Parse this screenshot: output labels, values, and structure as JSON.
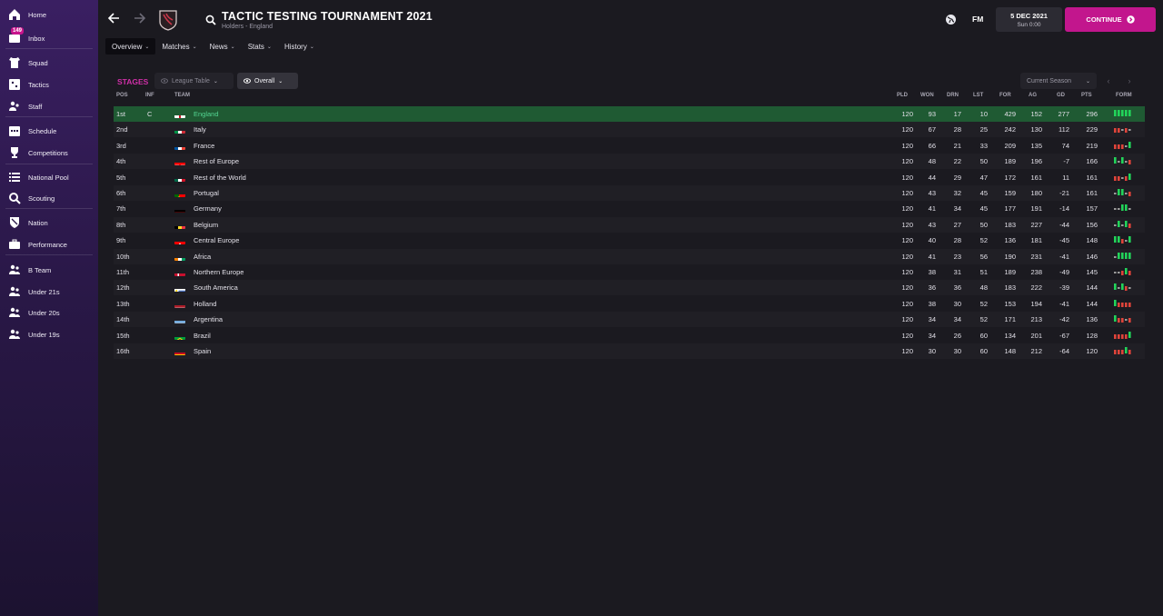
{
  "colors": {
    "accent": "#c2168d",
    "stages": "#d02fa8",
    "leader_row": "#1f5a33",
    "leader_text": "#53d692",
    "win": "#22d45a",
    "draw": "#9a9a9a",
    "loss": "#e0443a"
  },
  "sidebar": {
    "inbox_badge": "149",
    "items": [
      {
        "label": "Home",
        "icon": "home-icon"
      },
      {
        "label": "Inbox",
        "icon": "inbox-icon"
      },
      {
        "label": "Squad",
        "icon": "shirt-icon"
      },
      {
        "label": "Tactics",
        "icon": "tactics-board-icon"
      },
      {
        "label": "Staff",
        "icon": "staff-icon"
      },
      {
        "label": "Schedule",
        "icon": "calendar-icon"
      },
      {
        "label": "Competitions",
        "icon": "trophy-icon"
      },
      {
        "label": "National Pool",
        "icon": "list-icon"
      },
      {
        "label": "Scouting",
        "icon": "magnifier-icon"
      },
      {
        "label": "Nation",
        "icon": "shield-icon"
      },
      {
        "label": "Performance",
        "icon": "briefcase-icon"
      },
      {
        "label": "B Team",
        "icon": "b-team-icon"
      },
      {
        "label": "Under 21s",
        "icon": "under-21-icon"
      },
      {
        "label": "Under 20s",
        "icon": "under-20-icon"
      },
      {
        "label": "Under 19s",
        "icon": "under-19-icon"
      }
    ]
  },
  "header": {
    "title": "TACTIC TESTING TOURNAMENT 2021",
    "subtitle": "Holders - England",
    "fm_label": "FM",
    "date": "5 DEC 2021",
    "time": "Sun 0:00",
    "continue_label": "CONTINUE"
  },
  "tabs": [
    {
      "label": "Overview",
      "active": true
    },
    {
      "label": "Matches",
      "active": false
    },
    {
      "label": "News",
      "active": false
    },
    {
      "label": "Stats",
      "active": false
    },
    {
      "label": "History",
      "active": false
    }
  ],
  "stages": {
    "label": "STAGES",
    "league_table": "League Table",
    "overall": "Overall",
    "season": "Current Season"
  },
  "table": {
    "headers": {
      "pos": "POS",
      "inf": "INF",
      "team": "TEAM",
      "pld": "PLD",
      "won": "WON",
      "drn": "DRN",
      "lst": "LST",
      "for": "FOR",
      "ag": "AG",
      "gd": "GD",
      "pts": "PTS",
      "form": "FORM"
    },
    "rows": [
      {
        "pos": "1st",
        "inf": "C",
        "team": "England",
        "flag": "england",
        "pld": "120",
        "won": "93",
        "drn": "17",
        "lst": "10",
        "for": "429",
        "ag": "152",
        "gd": "277",
        "pts": "296",
        "form": [
          "W",
          "W",
          "W",
          "W",
          "W"
        ]
      },
      {
        "pos": "2nd",
        "inf": "",
        "team": "Italy",
        "flag": "italy",
        "pld": "120",
        "won": "67",
        "drn": "28",
        "lst": "25",
        "for": "242",
        "ag": "130",
        "gd": "112",
        "pts": "229",
        "form": [
          "L",
          "L",
          "D",
          "L",
          "D"
        ]
      },
      {
        "pos": "3rd",
        "inf": "",
        "team": "France",
        "flag": "france",
        "pld": "120",
        "won": "66",
        "drn": "21",
        "lst": "33",
        "for": "209",
        "ag": "135",
        "gd": "74",
        "pts": "219",
        "form": [
          "L",
          "L",
          "L",
          "D",
          "W"
        ]
      },
      {
        "pos": "4th",
        "inf": "",
        "team": "Rest of Europe",
        "flag": "croatia",
        "pld": "120",
        "won": "48",
        "drn": "22",
        "lst": "50",
        "for": "189",
        "ag": "196",
        "gd": "-7",
        "pts": "166",
        "form": [
          "W",
          "D",
          "W",
          "D",
          "L"
        ]
      },
      {
        "pos": "5th",
        "inf": "",
        "team": "Rest of the World",
        "flag": "mexico",
        "pld": "120",
        "won": "44",
        "drn": "29",
        "lst": "47",
        "for": "172",
        "ag": "161",
        "gd": "11",
        "pts": "161",
        "form": [
          "L",
          "L",
          "D",
          "L",
          "W"
        ]
      },
      {
        "pos": "6th",
        "inf": "",
        "team": "Portugal",
        "flag": "portugal",
        "pld": "120",
        "won": "43",
        "drn": "32",
        "lst": "45",
        "for": "159",
        "ag": "180",
        "gd": "-21",
        "pts": "161",
        "form": [
          "D",
          "W",
          "W",
          "D",
          "L"
        ]
      },
      {
        "pos": "7th",
        "inf": "",
        "team": "Germany",
        "flag": "germany",
        "pld": "120",
        "won": "41",
        "drn": "34",
        "lst": "45",
        "for": "177",
        "ag": "191",
        "gd": "-14",
        "pts": "157",
        "form": [
          "D",
          "D",
          "W",
          "W",
          "D"
        ]
      },
      {
        "pos": "8th",
        "inf": "",
        "team": "Belgium",
        "flag": "belgium",
        "pld": "120",
        "won": "43",
        "drn": "27",
        "lst": "50",
        "for": "183",
        "ag": "227",
        "gd": "-44",
        "pts": "156",
        "form": [
          "D",
          "W",
          "D",
          "W",
          "L"
        ]
      },
      {
        "pos": "9th",
        "inf": "",
        "team": "Central Europe",
        "flag": "switzerland",
        "pld": "120",
        "won": "40",
        "drn": "28",
        "lst": "52",
        "for": "136",
        "ag": "181",
        "gd": "-45",
        "pts": "148",
        "form": [
          "W",
          "W",
          "L",
          "D",
          "W"
        ]
      },
      {
        "pos": "10th",
        "inf": "",
        "team": "Africa",
        "flag": "ivory-coast",
        "pld": "120",
        "won": "41",
        "drn": "23",
        "lst": "56",
        "for": "190",
        "ag": "231",
        "gd": "-41",
        "pts": "146",
        "form": [
          "D",
          "W",
          "W",
          "W",
          "W"
        ]
      },
      {
        "pos": "11th",
        "inf": "",
        "team": "Northern Europe",
        "flag": "denmark",
        "pld": "120",
        "won": "38",
        "drn": "31",
        "lst": "51",
        "for": "189",
        "ag": "238",
        "gd": "-49",
        "pts": "145",
        "form": [
          "D",
          "D",
          "L",
          "W",
          "L"
        ]
      },
      {
        "pos": "12th",
        "inf": "",
        "team": "South America",
        "flag": "uruguay",
        "pld": "120",
        "won": "36",
        "drn": "36",
        "lst": "48",
        "for": "183",
        "ag": "222",
        "gd": "-39",
        "pts": "144",
        "form": [
          "W",
          "D",
          "W",
          "L",
          "D"
        ]
      },
      {
        "pos": "13th",
        "inf": "",
        "team": "Holland",
        "flag": "netherlands",
        "pld": "120",
        "won": "38",
        "drn": "30",
        "lst": "52",
        "for": "153",
        "ag": "194",
        "gd": "-41",
        "pts": "144",
        "form": [
          "W",
          "L",
          "L",
          "L",
          "L"
        ]
      },
      {
        "pos": "14th",
        "inf": "",
        "team": "Argentina",
        "flag": "argentina",
        "pld": "120",
        "won": "34",
        "drn": "34",
        "lst": "52",
        "for": "171",
        "ag": "213",
        "gd": "-42",
        "pts": "136",
        "form": [
          "W",
          "L",
          "L",
          "D",
          "L"
        ]
      },
      {
        "pos": "15th",
        "inf": "",
        "team": "Brazil",
        "flag": "brazil",
        "pld": "120",
        "won": "34",
        "drn": "26",
        "lst": "60",
        "for": "134",
        "ag": "201",
        "gd": "-67",
        "pts": "128",
        "form": [
          "L",
          "L",
          "L",
          "L",
          "W"
        ]
      },
      {
        "pos": "16th",
        "inf": "",
        "team": "Spain",
        "flag": "spain",
        "pld": "120",
        "won": "30",
        "drn": "30",
        "lst": "60",
        "for": "148",
        "ag": "212",
        "gd": "-64",
        "pts": "120",
        "form": [
          "L",
          "L",
          "L",
          "W",
          "L"
        ]
      }
    ]
  }
}
